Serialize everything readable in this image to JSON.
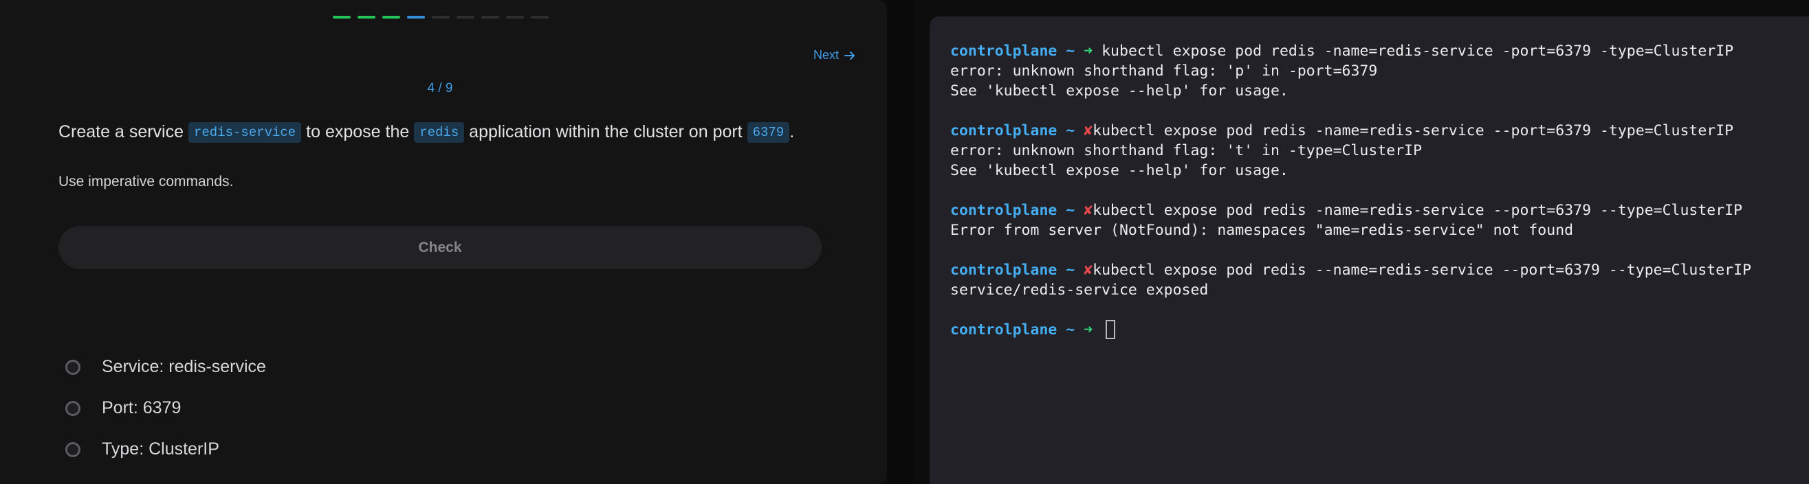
{
  "lesson": {
    "progress": {
      "total": 9,
      "done": 3,
      "current": 4
    },
    "next_label": "Next",
    "step_counter": "4 / 9",
    "question": {
      "part1": "Create a service ",
      "code1": "redis-service",
      "part2": " to expose the ",
      "code2": "redis",
      "part3": " application within the cluster on port ",
      "code3": "6379",
      "part4": "."
    },
    "instruction": "Use imperative commands.",
    "check_label": "Check",
    "checklist": [
      "Service: redis-service",
      "Port: 6379",
      "Type: ClusterIP"
    ]
  },
  "terminal": {
    "prompt_host": "controlplane",
    "prompt_tilde": "~",
    "entries": [
      {
        "status": "ok",
        "command": "kubectl expose pod redis -name=redis-service -port=6379 -type=ClusterIP",
        "output": [
          "error: unknown shorthand flag: 'p' in -port=6379",
          "See 'kubectl expose --help' for usage."
        ]
      },
      {
        "status": "error",
        "command": "kubectl expose pod redis -name=redis-service --port=6379 -type=ClusterIP",
        "output": [
          "error: unknown shorthand flag: 't' in -type=ClusterIP",
          "See 'kubectl expose --help' for usage."
        ]
      },
      {
        "status": "error",
        "command": "kubectl expose pod redis -name=redis-service --port=6379 --type=ClusterIP",
        "output": [
          "Error from server (NotFound): namespaces \"ame=redis-service\" not found"
        ]
      },
      {
        "status": "error",
        "command": "kubectl expose pod redis --name=redis-service --port=6379 --type=ClusterIP",
        "output": [
          "service/redis-service exposed"
        ]
      }
    ],
    "final_prompt_status": "ok",
    "colors": {
      "host": "#45aef2",
      "ok_arrow": "#33d67a",
      "error_x": "#e8474b"
    }
  }
}
